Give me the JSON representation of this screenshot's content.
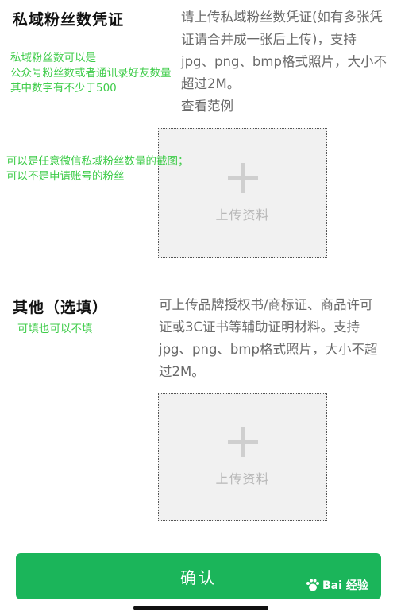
{
  "section1": {
    "title": "私域粉丝数凭证",
    "description": "请上传私域粉丝数凭证(如有多张凭证请合并成一张后上传)，支持jpg、png、bmp格式照片，大小不超过2M。",
    "example_link": "查看范例",
    "upload_label": "上传资料"
  },
  "section2": {
    "title": "其他（选填）",
    "description": "可上传品牌授权书/商标证、商品许可证或3C证书等辅助证明材料。支持jpg、png、bmp格式照片，大小不超过2M。",
    "upload_label": "上传资料"
  },
  "annotations": {
    "note1_line1": "私域粉丝数可以是",
    "note1_line2": "公众号粉丝数或者通讯录好友数量",
    "note1_line3": "其中数字有不少于500",
    "note2_line1": "可以是任意微信私域粉丝数量的截图；",
    "note2_line2": "可以不是申请账号的粉丝",
    "note3": "可填也可以不填"
  },
  "confirm_button": "确认",
  "watermark": "Bai 经验",
  "colors": {
    "accent": "#1bb55a",
    "annotation": "#3fcc4a"
  }
}
